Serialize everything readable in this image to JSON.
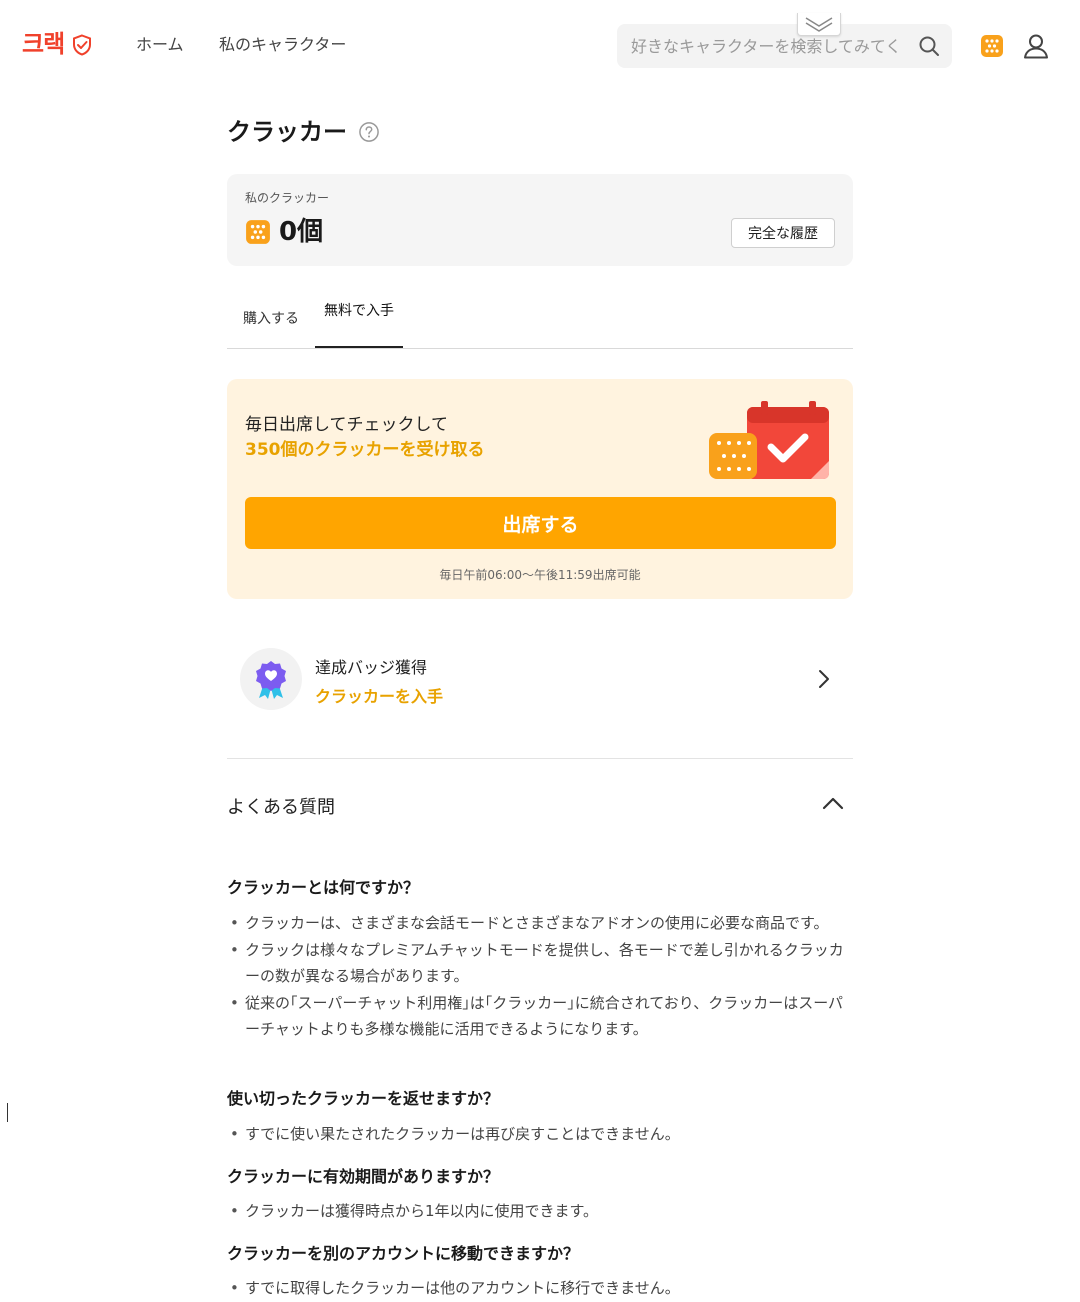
{
  "app": {
    "logo_text": "크랙",
    "nav": {
      "home": "ホーム",
      "my_characters": "私のキャラクター"
    },
    "search": {
      "placeholder": "好きなキャラクターを検索してみてください",
      "value": ""
    }
  },
  "page": {
    "title": "クラッカー",
    "balance": {
      "label": "私のクラッカー",
      "value": "0個",
      "history_button": "完全な履歴"
    },
    "tabs": [
      {
        "label": "購入する",
        "active": false
      },
      {
        "label": "無料で入手",
        "active": true
      }
    ],
    "attendance": {
      "line1": "毎日出席してチェックして",
      "line2": "350個のクラッカーを受け取る",
      "button": "出席する",
      "note": "毎日午前06:00～午後11:59出席可能"
    },
    "badge": {
      "title": "達成バッジ獲得",
      "subtitle": "クラッカーを入手"
    },
    "faq": {
      "title": "よくある質問",
      "expanded": true,
      "items": [
        {
          "question": "クラッカーとは何ですか？",
          "answers": [
            "クラッカーは、さまざまな会話モードとさまざまなアドオンの使用に必要な商品です。",
            "クラックは様々なプレミアムチャットモードを提供し、各モードで差し引かれるクラッカーの数が異なる場合があります。",
            "従来の｢スーパーチャット利用権｣は｢クラッカー｣に統合されており、クラッカーはスーパーチャットよりも多様な機能に活用できるようになります。"
          ]
        },
        {
          "question": "使い切ったクラッカーを返せますか？",
          "answers": [
            "すでに使い果たされたクラッカーは再び戻すことはできません。"
          ]
        },
        {
          "question": "クラッカーに有効期間がありますか？",
          "answers": [
            "クラッカーは獲得時点から1年以内に使用できます。"
          ]
        },
        {
          "question": "クラッカーを別のアカウントに移動できますか？",
          "answers": [
            "すでに取得したクラッカーは他のアカウントに移行できません。"
          ]
        }
      ]
    }
  },
  "colors": {
    "brand": "#f0412b",
    "accent": "#ffa500",
    "accent_text": "#e8a200",
    "attend_bg": "#fff3df"
  },
  "icons": {
    "logo": "shield-check-icon",
    "search": "search-icon",
    "cracker": "cracker-icon",
    "user": "user-icon",
    "help": "question-circle-icon",
    "calendar": "calendar-check-icon",
    "badge": "award-badge-icon",
    "chevron_right": "chevron-right-icon",
    "chevron_up": "chevron-up-icon"
  }
}
